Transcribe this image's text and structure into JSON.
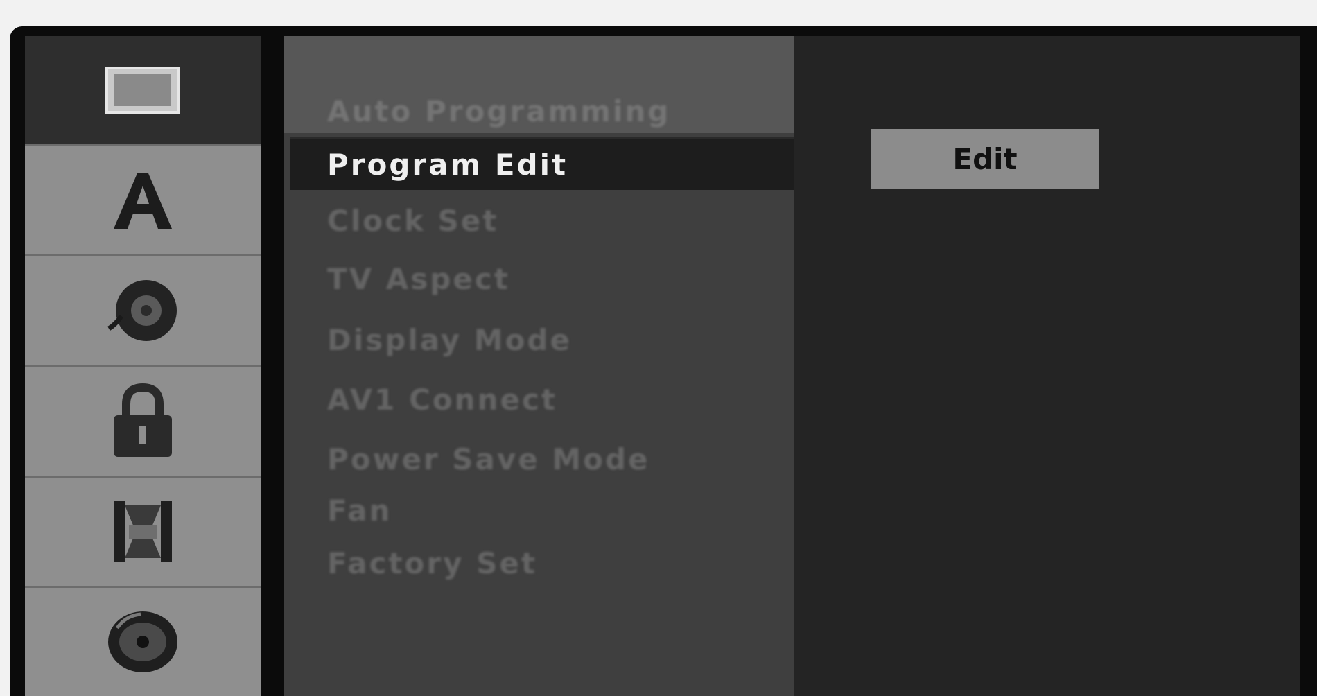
{
  "sidebar": {
    "items": [
      {
        "icon": "display-icon",
        "selected": true
      },
      {
        "icon": "language-icon",
        "selected": false
      },
      {
        "icon": "audio-icon",
        "selected": false
      },
      {
        "icon": "lock-icon",
        "selected": false
      },
      {
        "icon": "recording-icon",
        "selected": false
      },
      {
        "icon": "disc-icon",
        "selected": false
      }
    ]
  },
  "menu": {
    "heading": "Auto Programming",
    "items": [
      {
        "label": "Program Edit",
        "selected": true
      },
      {
        "label": "Clock Set",
        "selected": false
      },
      {
        "label": "TV Aspect",
        "selected": false
      },
      {
        "label": "Display Mode",
        "selected": false
      },
      {
        "label": "AV1 Connect",
        "selected": false
      },
      {
        "label": "Power Save Mode",
        "selected": false
      },
      {
        "label": "Fan",
        "selected": false
      },
      {
        "label": "Factory Set",
        "selected": false
      }
    ]
  },
  "options": {
    "button_label": "Edit"
  },
  "colors": {
    "sidebar_bg": "#8f8f8f",
    "sidebar_selected": "#2e2e2e",
    "menu_bg": "#3f3f3f",
    "menu_selected": "#1d1d1d",
    "options_bg": "#242424",
    "button_bg": "#8c8c8c"
  }
}
